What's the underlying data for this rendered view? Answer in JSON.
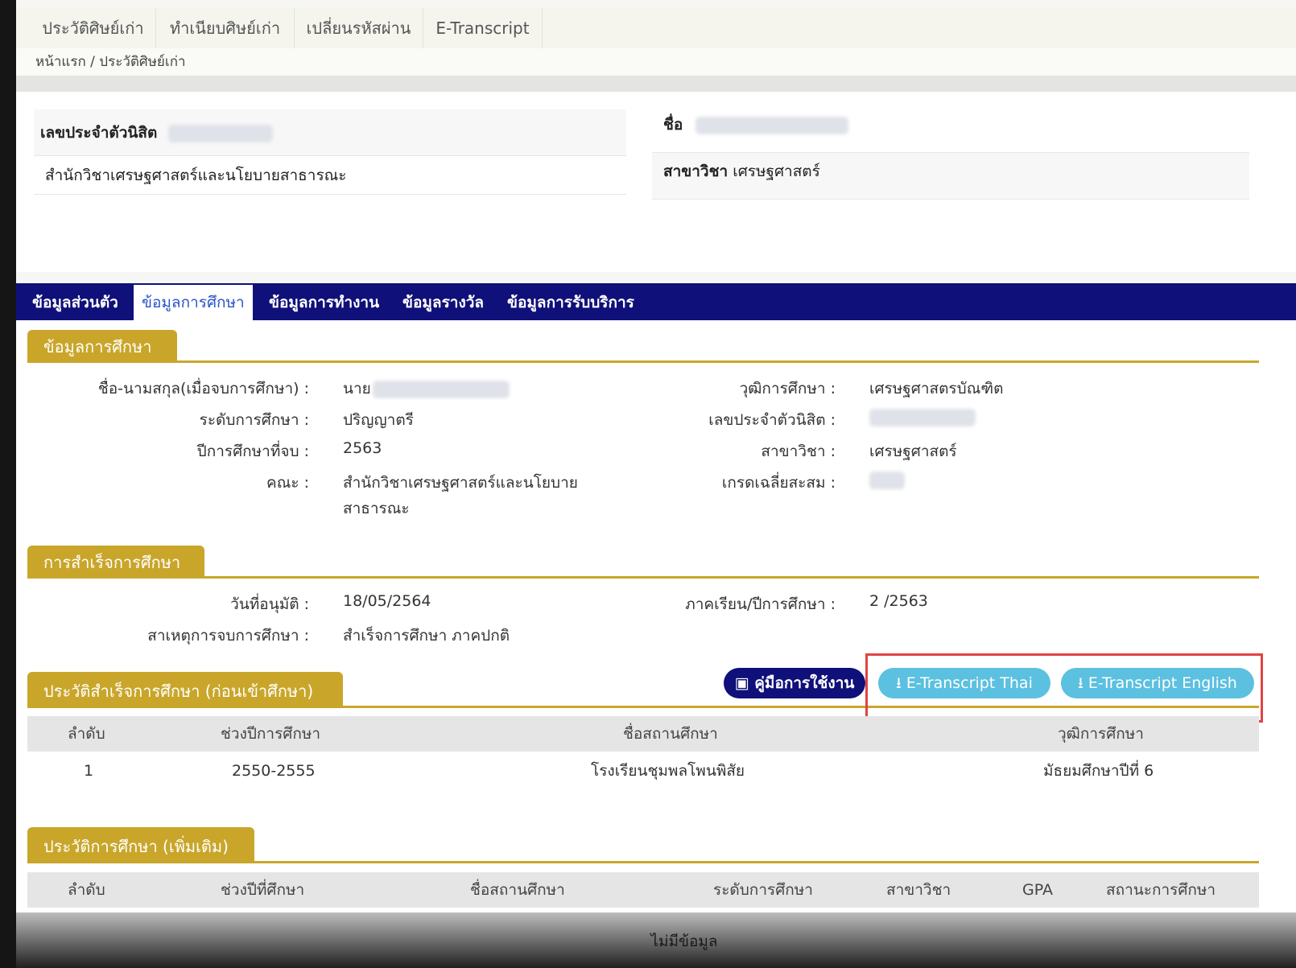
{
  "topnav": {
    "items": [
      "ประวัติศิษย์เก่า",
      "ทำเนียบศิษย์เก่า",
      "เปลี่ยนรหัสผ่าน",
      "E-Transcript"
    ]
  },
  "breadcrumb": "หน้าแรก / ประวัติศิษย์เก่า",
  "header": {
    "student_id_label": "เลขประจำตัวนิสิต",
    "name_label": "ชื่อ",
    "faculty": "สำนักวิชาเศรษฐศาสตร์และนโยบายสาธารณะ",
    "major_label": "สาขาวิชา",
    "major_value": "เศรษฐศาสตร์"
  },
  "tabs": [
    "ข้อมูลส่วนตัว",
    "ข้อมูลการศึกษา",
    "ข้อมูลการทำงาน",
    "ข้อมูลรางวัล",
    "ข้อมูลการรับบริการ"
  ],
  "education": {
    "title": "ข้อมูลการศึกษา",
    "fullname_label": "ชื่อ-นามสกุล(เมื่อจบการศึกษา) :",
    "fullname_prefix": "นาย",
    "level_label": "ระดับการศึกษา :",
    "level_value": "ปริญญาตรี",
    "grad_year_label": "ปีการศึกษาที่จบ :",
    "grad_year_value": "2563",
    "faculty_label": "คณะ :",
    "faculty_value_1": "สำนักวิชาเศรษฐศาสตร์และนโยบาย",
    "faculty_value_2": "สาธารณะ",
    "degree_label": "วุฒิการศึกษา :",
    "degree_value": "เศรษฐศาสตรบัณฑิต",
    "student_id_label": "เลขประจำตัวนิสิต :",
    "major_label": "สาขาวิชา :",
    "major_value": "เศรษฐศาสตร์",
    "gpa_label": "เกรดเฉลี่ยสะสม :"
  },
  "graduation": {
    "title": "การสำเร็จการศึกษา",
    "approve_label": "วันที่อนุมัติ :",
    "approve_value": "18/05/2564",
    "term_label": "ภาคเรียน/ปีการศึกษา :",
    "term_value": "2 /2563",
    "reason_label": "สาเหตุการจบการศึกษา :",
    "reason_value": "สำเร็จการศึกษา ภาคปกติ"
  },
  "prior": {
    "title": "ประวัติสำเร็จการศึกษา (ก่อนเข้าศึกษา)",
    "manual_button": "คู่มือการใช้งาน",
    "thai_button": "E-Transcript Thai",
    "eng_button": "E-Transcript English",
    "headers": [
      "ลำดับ",
      "ช่วงปีการศึกษา",
      "ชื่อสถานศึกษา",
      "วุฒิการศึกษา"
    ],
    "rows": [
      [
        "1",
        "2550-2555",
        "โรงเรียนชุมพลโพนพิสัย",
        "มัธยมศึกษาปีที่ 6"
      ]
    ]
  },
  "additional": {
    "title": "ประวัติการศึกษา (เพิ่มเติม)",
    "headers": [
      "ลำดับ",
      "ช่วงปีที่ศึกษา",
      "ชื่อสถานศึกษา",
      "ระดับการศึกษา",
      "สาขาวิชา",
      "GPA",
      "สถานะการศึกษา"
    ],
    "empty_text": "ไม่มีข้อมูล"
  },
  "colors": {
    "navy": "#10107a",
    "gold": "#c9a62a",
    "button_blue": "#5cc0e0",
    "highlight_red": "#e04444"
  }
}
